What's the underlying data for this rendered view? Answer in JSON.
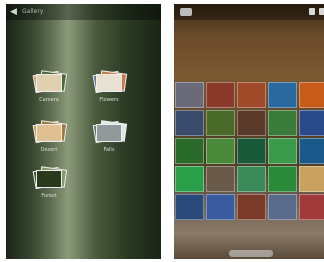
{
  "left_screen": {
    "header": {
      "back_glyph": "◀",
      "title": "Gallery"
    },
    "albums": [
      {
        "label": "Camera",
        "colors": [
          "#c8a070",
          "#4a6a3a",
          "#e0d0b0"
        ]
      },
      {
        "label": "Flowers",
        "colors": [
          "#5a7a9a",
          "#c87a4a",
          "#e8e0d0"
        ]
      },
      {
        "label": "Desert",
        "colors": [
          "#c89a5a",
          "#a07840",
          "#e0c090"
        ]
      },
      {
        "label": "Falls",
        "colors": [
          "#6a7a7a",
          "#dfe8e8",
          "#909a9a"
        ]
      },
      {
        "label": "Forest",
        "colors": [
          "#3a5a2a",
          "#8a9a6a",
          "#2a3a1e"
        ]
      }
    ]
  },
  "right_screen": {
    "thumbnails": [
      "#6a6a7a",
      "#8a3a2a",
      "#a04a2a",
      "#2a6aa0",
      "#c85a1a",
      "#3a4a6a",
      "#4a6a2a",
      "#5a3a2a",
      "#3a7a3a",
      "#2a4a8a",
      "#2a6a2a",
      "#4a8a3a",
      "#1a5a3a",
      "#3a9a4a",
      "#1a5a8a",
      "#2aa04a",
      "#6a5a4a",
      "#3a8a5a",
      "#2a8a3a",
      "#c8a060",
      "#2a4a7a",
      "#3a5aa0",
      "#7a3a2a",
      "#5a6a8a",
      "#a03a3a"
    ]
  }
}
